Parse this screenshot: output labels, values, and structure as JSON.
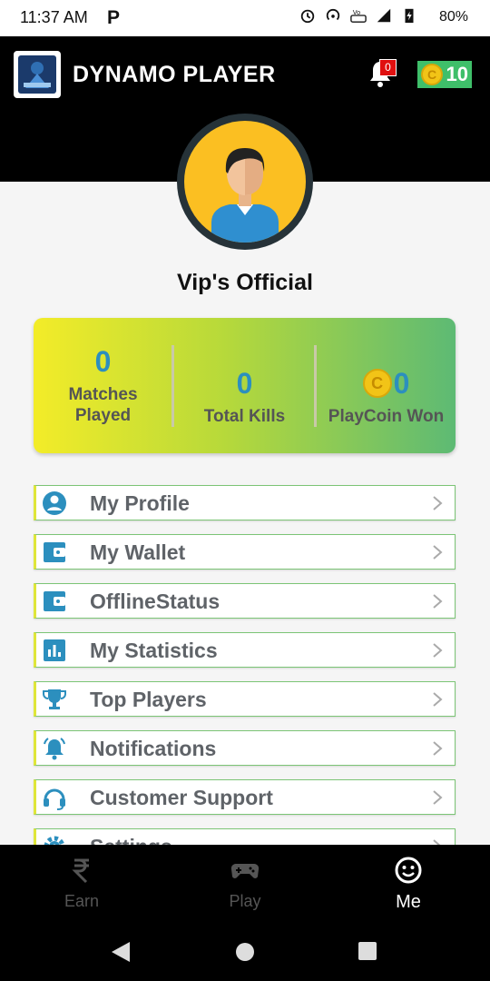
{
  "status_bar": {
    "time": "11:37 AM",
    "network": "4G",
    "volte": "VoLTE",
    "battery": "80%"
  },
  "app_bar": {
    "title": "DYNAMO PLAYER",
    "notification_count": "0",
    "coin_balance": "10"
  },
  "profile": {
    "name": "Vip's Official"
  },
  "stats": [
    {
      "value": "0",
      "label_line1": "Matches",
      "label_line2": "Played"
    },
    {
      "value": "0",
      "label_line1": "Total Kills",
      "label_line2": ""
    },
    {
      "value": "0",
      "label_line1": "PlayCoin Won",
      "label_line2": ""
    }
  ],
  "menu": [
    {
      "label": "My Profile",
      "icon": "account-circle-icon"
    },
    {
      "label": "My Wallet",
      "icon": "wallet-icon"
    },
    {
      "label": "OfflineStatus",
      "icon": "wallet-icon"
    },
    {
      "label": "My Statistics",
      "icon": "bar-chart-icon"
    },
    {
      "label": "Top Players",
      "icon": "trophy-icon"
    },
    {
      "label": "Notifications",
      "icon": "bell-ring-icon"
    },
    {
      "label": "Customer Support",
      "icon": "headset-icon"
    },
    {
      "label": "Settings",
      "icon": "gear-icon"
    }
  ],
  "bottom_nav": [
    {
      "label": "Earn",
      "icon": "rupee-icon",
      "active": false
    },
    {
      "label": "Play",
      "icon": "gamepad-icon",
      "active": false
    },
    {
      "label": "Me",
      "icon": "smiley-icon",
      "active": true
    }
  ],
  "colors": {
    "accent_blue": "#2c8fbe",
    "menu_green": "#7cc576",
    "avatar_yellow": "#fbbf22"
  }
}
